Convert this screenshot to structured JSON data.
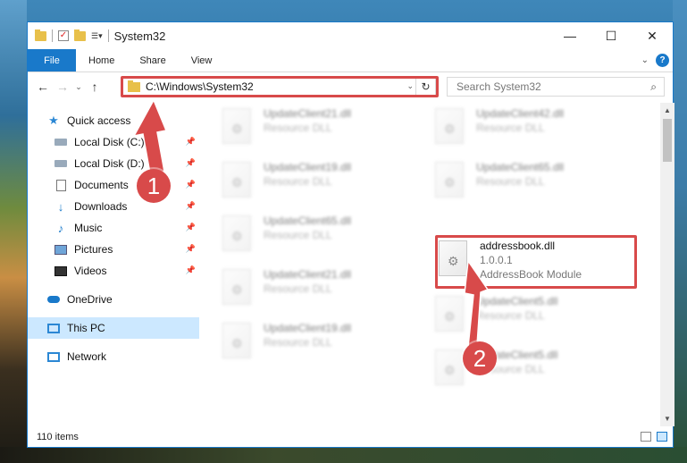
{
  "window": {
    "title": "System32",
    "controls": {
      "minimize": "—",
      "maximize": "☐",
      "close": "✕"
    }
  },
  "ribbon": {
    "file_tab": "File",
    "tabs": [
      "Home",
      "Share",
      "View"
    ]
  },
  "nav": {
    "address_path": "C:\\Windows\\System32",
    "search_placeholder": "Search System32"
  },
  "sidebar": {
    "quick_access": "Quick access",
    "items": [
      {
        "label": "Local Disk (C:)",
        "icon": "disk-icon",
        "pinned": true
      },
      {
        "label": "Local Disk (D:)",
        "icon": "disk-icon",
        "pinned": true
      },
      {
        "label": "Documents",
        "icon": "documents-icon",
        "pinned": true
      },
      {
        "label": "Downloads",
        "icon": "downloads-icon",
        "pinned": true
      },
      {
        "label": "Music",
        "icon": "music-icon",
        "pinned": true
      },
      {
        "label": "Pictures",
        "icon": "pictures-icon",
        "pinned": true
      },
      {
        "label": "Videos",
        "icon": "videos-icon",
        "pinned": true
      }
    ],
    "onedrive": "OneDrive",
    "this_pc": "This PC",
    "network": "Network"
  },
  "files": {
    "left_column": [
      {
        "name": "UpdateClient21.dll",
        "desc": "Resource DLL"
      },
      {
        "name": "UpdateClient19.dll",
        "desc": "Resource DLL"
      },
      {
        "name": "UpdateClient65.dll",
        "desc": "Resource DLL"
      },
      {
        "name": "UpdateClient21.dll",
        "desc": "Resource DLL"
      },
      {
        "name": "UpdateClient19.dll",
        "desc": "Resource DLL"
      }
    ],
    "right_column": [
      {
        "name": "UpdateClient42.dll",
        "desc": "Resource DLL"
      },
      {
        "name": "UpdateClient65.dll",
        "desc": "Resource DLL"
      },
      {
        "name": "UpdateClient5.dll",
        "desc": "Resource DLL"
      },
      {
        "name": "UpdateClient5.dll",
        "desc": "Resource DLL"
      }
    ],
    "highlighted": {
      "name": "addressbook.dll",
      "version": "1.0.0.1",
      "desc": "AddressBook Module"
    }
  },
  "status": {
    "item_count": "110 items"
  },
  "annotations": {
    "step1": "1",
    "step2": "2",
    "color": "#d84a4a"
  },
  "colors": {
    "accent": "#1979ca",
    "selection": "#cce8ff"
  }
}
